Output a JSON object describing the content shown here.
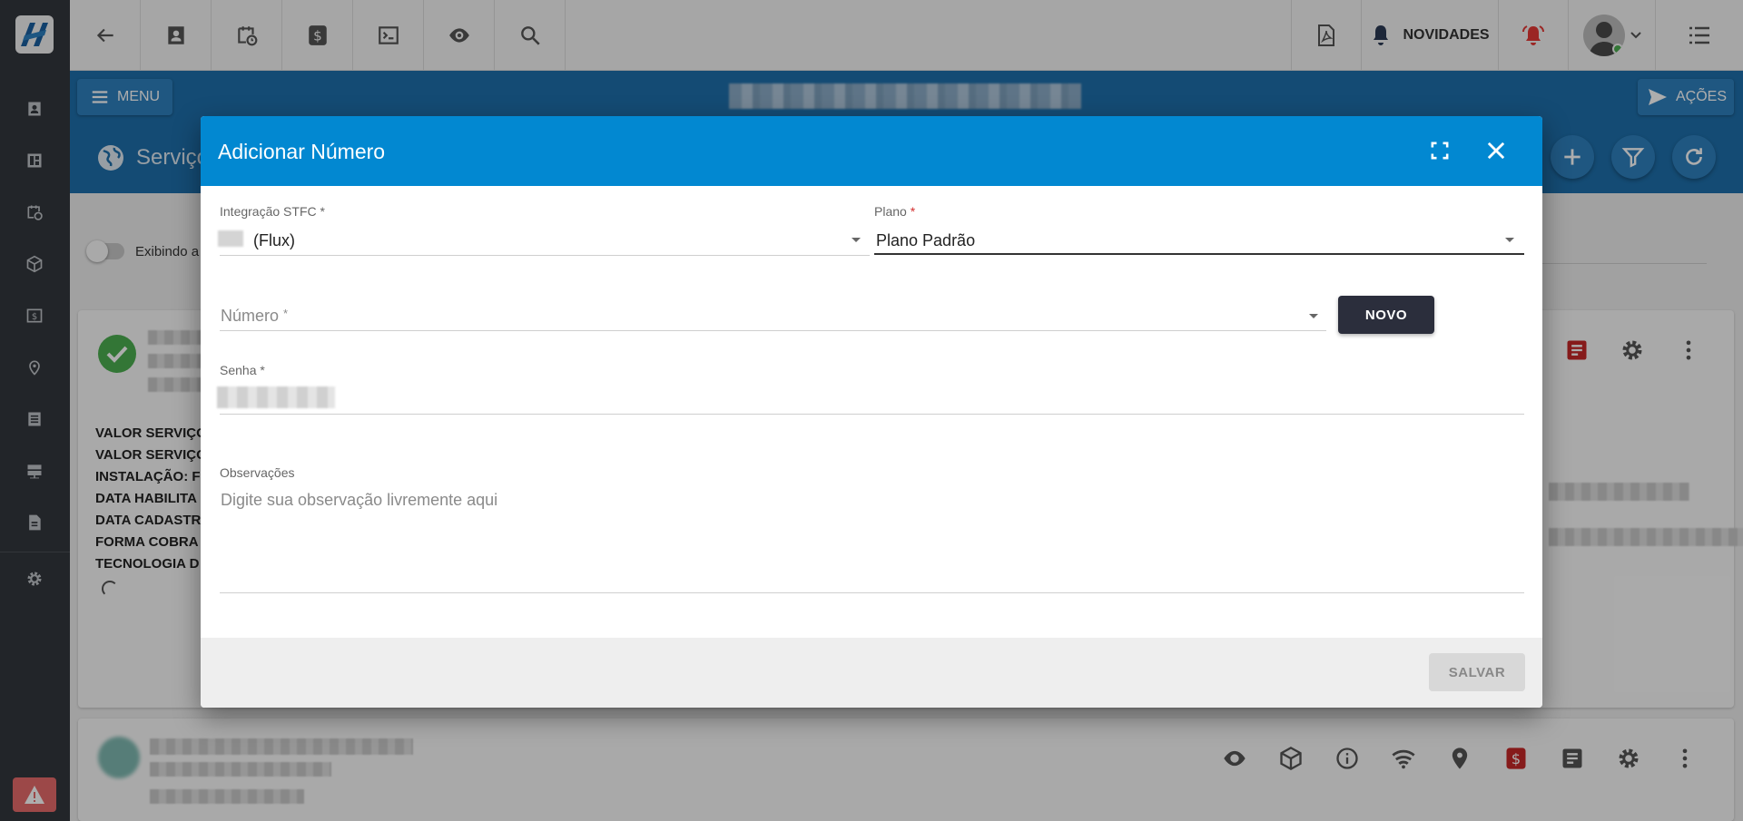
{
  "topbar": {
    "novidades_label": "NOVIDADES"
  },
  "header": {
    "menu_label": "MENU",
    "acoes_label": "AÇÕES",
    "page_title": "Serviço"
  },
  "background": {
    "toggle_label": "Exibindo a",
    "info_lines": [
      "VALOR SERVIÇO",
      "VALOR SERVIÇO",
      "INSTALAÇÃO: F",
      "DATA HABILITA",
      "DATA CADASTR",
      "FORMA COBRA",
      "TECNOLOGIA D"
    ]
  },
  "dialog": {
    "title": "Adicionar Número",
    "fields": {
      "integracao": {
        "label": "Integração STFC",
        "required_mark": "*",
        "value": "(Flux)"
      },
      "plano": {
        "label": "Plano",
        "required_mark": "*",
        "value": "Plano Padrão"
      },
      "numero": {
        "placeholder": "Número",
        "required_mark": "*"
      },
      "senha": {
        "label": "Senha",
        "required_mark": "*"
      },
      "observacoes": {
        "label": "Observações",
        "placeholder": "Digite sua observação livremente aqui"
      }
    },
    "novo_label": "NOVO",
    "salvar_label": "SALVAR"
  },
  "colors": {
    "dialog_header": "#0288d1",
    "header_band": "#1e6fab",
    "sidebar": "#33373d",
    "novo_button": "#2b2e3c",
    "alert_bell": "#e53935",
    "success": "#4caf50"
  },
  "icons": {
    "sidebar": [
      "contact-icon",
      "dashboard-icon",
      "schedule-icon",
      "package-icon",
      "money-icon",
      "location-icon",
      "list-icon",
      "server-icon",
      "document-icon",
      "gear-icon"
    ],
    "toolbar": [
      "back-icon",
      "contact-card-icon",
      "calendar-clock-icon",
      "dollar-icon",
      "terminal-icon",
      "eye-icon",
      "search-icon",
      "pdf-icon",
      "bell-icon",
      "alarm-bell-icon",
      "avatar",
      "menu-list-icon"
    ]
  }
}
